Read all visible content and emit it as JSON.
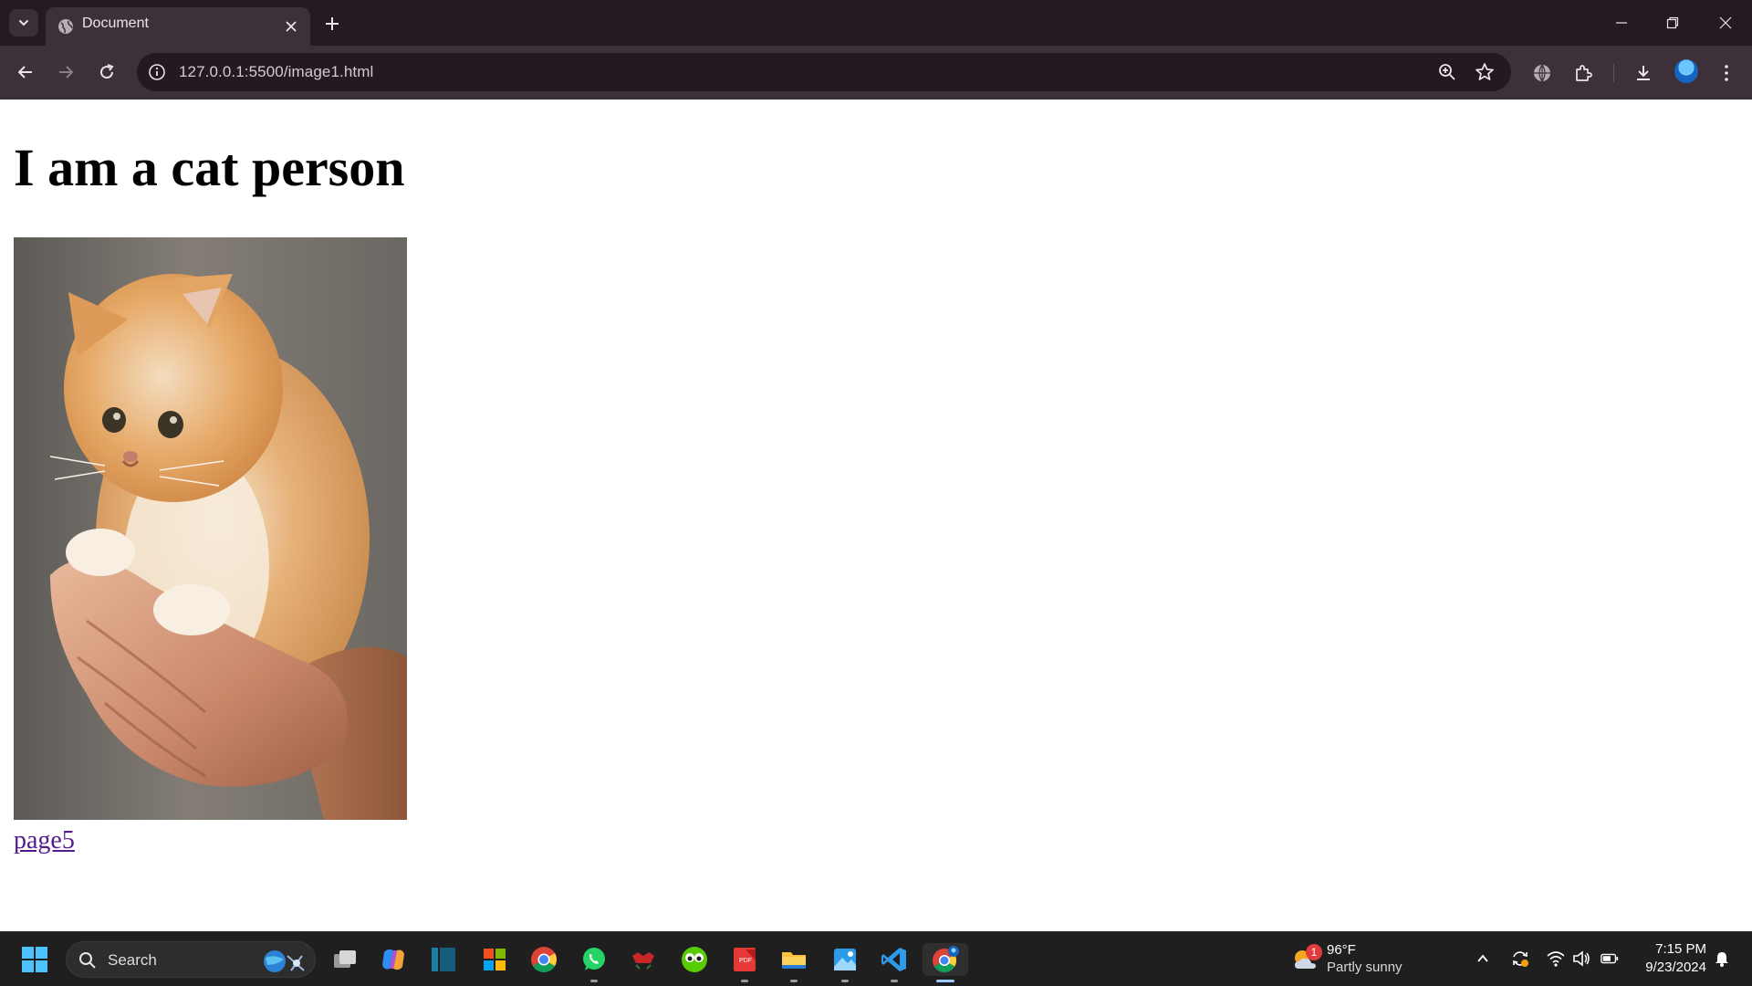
{
  "browser": {
    "tab": {
      "title": "Document"
    },
    "address_bar": {
      "url": "127.0.0.1:5500/image1.html"
    }
  },
  "page": {
    "heading": "I am a cat person",
    "image": {
      "icon": "kitten-photo",
      "description_visible": false
    },
    "link": {
      "label": "page5"
    }
  },
  "taskbar": {
    "search": {
      "label": "Search"
    },
    "apps": [
      "task-view",
      "copilot",
      "sidebar-app",
      "microsoft-store",
      "chrome",
      "whatsapp",
      "game-app",
      "duolingo",
      "pdf-app",
      "file-explorer",
      "photos",
      "vscode",
      "chrome-active"
    ],
    "weather": {
      "temperature": "96°F",
      "condition": "Partly sunny",
      "badge": "1"
    },
    "clock": {
      "time": "7:15 PM",
      "date": "9/23/2024"
    }
  },
  "colors": {
    "tabbar_bg": "#241a21",
    "toolbar_bg": "#3d3139",
    "omnibox_bg": "#231a21",
    "taskbar_bg": "#1f1f1f",
    "link": "#551a8b"
  }
}
